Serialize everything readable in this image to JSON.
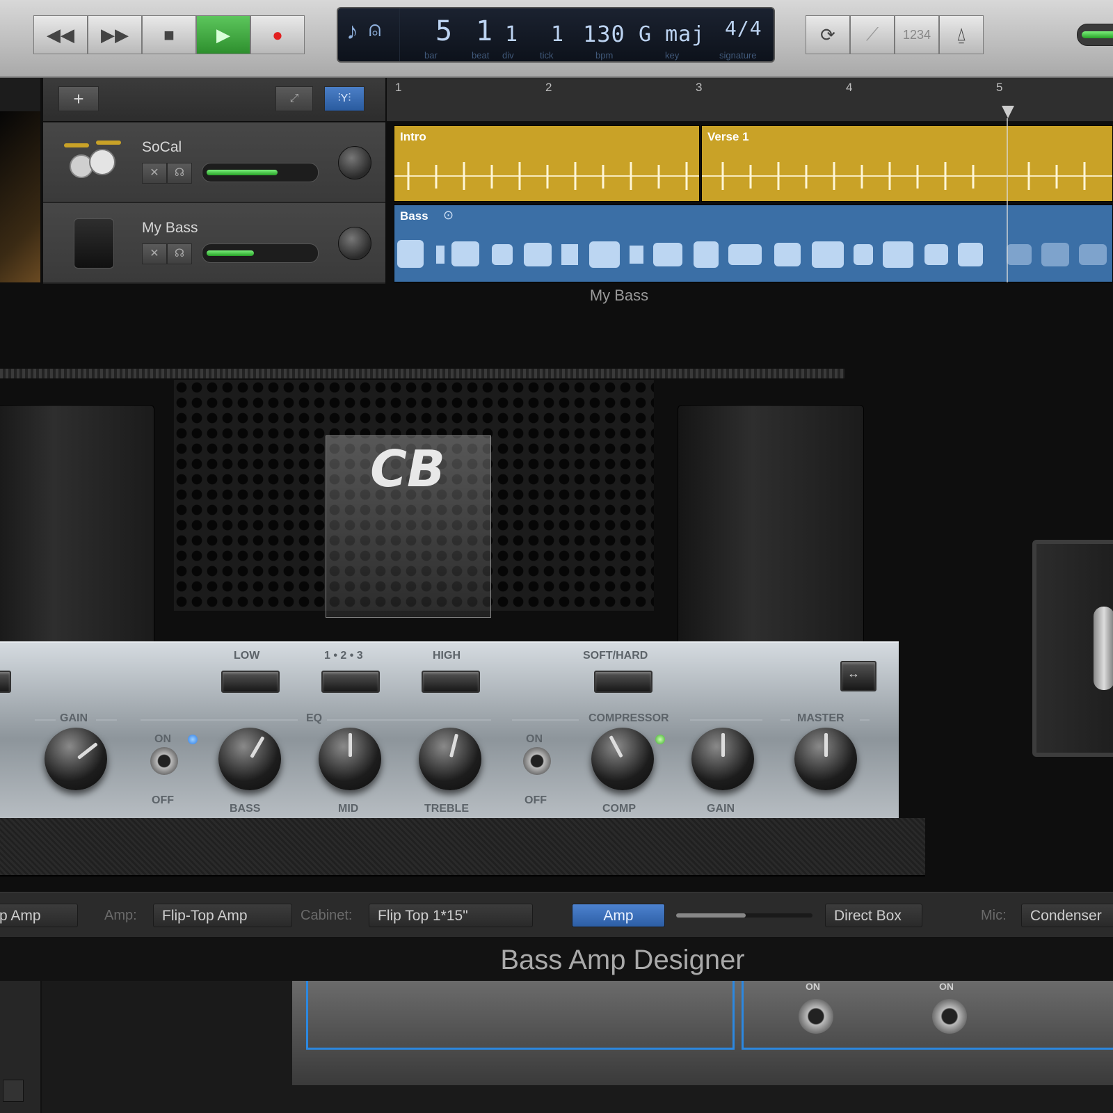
{
  "transport": {
    "rewind_icon": "rewind-icon",
    "forward_icon": "fast-forward-icon",
    "stop_icon": "stop-icon",
    "play_icon": "play-icon",
    "record_icon": "record-icon"
  },
  "lcd": {
    "bar": "5",
    "bar_label": "bar",
    "beat": "1",
    "beat_label": "beat",
    "div": "1",
    "div_label": "div",
    "tick": "1",
    "tick_label": "tick",
    "tempo": "130",
    "tempo_label": "bpm",
    "key": "G maj",
    "key_label": "key",
    "signature": "4/4",
    "signature_label": "signature"
  },
  "right_controls": {
    "count_in_label": "1234"
  },
  "tracks": [
    {
      "name": "SoCal",
      "fader_fraction": 0.68
    },
    {
      "name": "My Bass",
      "fader_fraction": 0.45
    }
  ],
  "ruler": [
    "1",
    "2",
    "3",
    "4",
    "5"
  ],
  "regions": {
    "intro": "Intro",
    "verse": "Verse 1",
    "bass": "Bass"
  },
  "plugin": {
    "track_label": "My Bass",
    "logo": "CB",
    "switch_labels": {
      "low": "LOW",
      "range": "1 • 2 • 3",
      "high": "HIGH",
      "softhard": "SOFT/HARD"
    },
    "sections": {
      "gain": "GAIN",
      "eq": "EQ",
      "compressor": "COMPRESSOR",
      "master": "MASTER"
    },
    "on_label": "ON",
    "off_label": "OFF",
    "knobs": {
      "bass": "BASS",
      "mid": "MID",
      "treble": "TREBLE",
      "comp": "COMP",
      "gain": "GAIN"
    }
  },
  "bottom": {
    "model": "p Amp",
    "amp_label": "Amp:",
    "amp_value": "Flip-Top Amp",
    "cabinet_label": "Cabinet:",
    "cabinet_value": "Flip Top 1*15\"",
    "amp_button": "Amp",
    "direct_box": "Direct Box",
    "mic_label": "Mic:",
    "mic_value": "Condenser"
  },
  "title": "Bass Amp Designer",
  "lower": {
    "on1": "ON",
    "on2": "ON"
  },
  "colors": {
    "intro_region": "#c9a227",
    "bass_region": "#3b6fa6",
    "play_green": "#3fb33f",
    "accent_blue": "#3e74c6"
  }
}
